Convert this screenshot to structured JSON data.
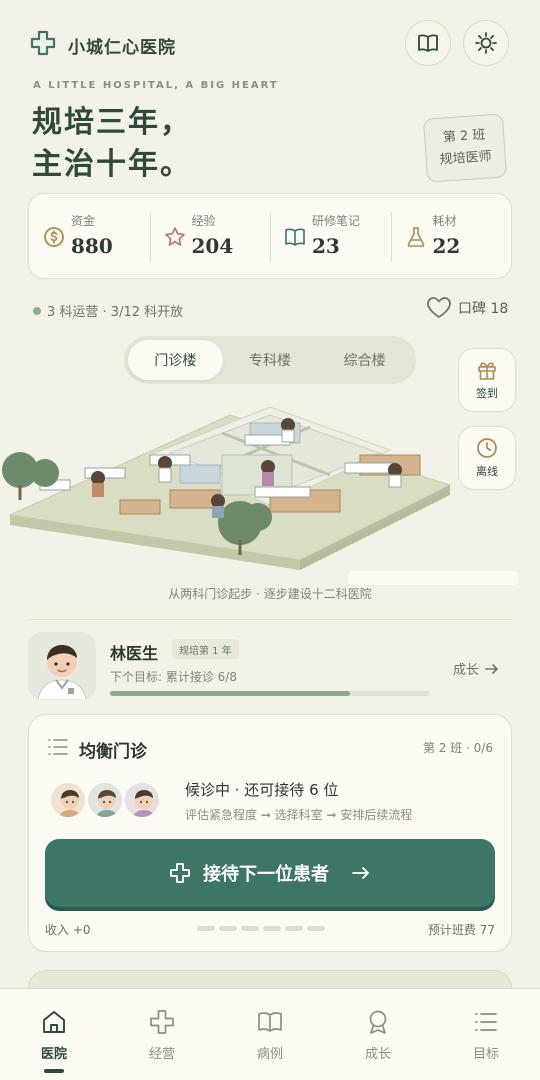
{
  "header": {
    "app_title": "小城仁心医院",
    "tagline": "A LITTLE HOSPITAL, A BIG HEART",
    "hero_line1": "规培三年，",
    "hero_line2": "主治十年。",
    "stamp_line1": "第 2 班",
    "stamp_line2": "规培医师",
    "buttons": [
      "book-icon",
      "sun-icon"
    ]
  },
  "stats": [
    {
      "label": "资金",
      "value": "880",
      "icon": "coin-icon"
    },
    {
      "label": "经验",
      "value": "204",
      "icon": "star-icon"
    },
    {
      "label": "研修笔记",
      "value": "23",
      "icon": "book-icon"
    },
    {
      "label": "耗材",
      "value": "22",
      "icon": "flask-icon"
    }
  ],
  "status": {
    "departments": "3 科运营 · 3/12 科开放",
    "reputation": "口碑 18"
  },
  "buildings": {
    "tabs": [
      "门诊楼",
      "专科楼",
      "综合楼"
    ],
    "active": 0,
    "caption": "从两科门诊起步 · 逐步建设十二科医院"
  },
  "side_buttons": [
    {
      "label": "签到",
      "icon": "gift-icon"
    },
    {
      "label": "离线",
      "icon": "clock-icon"
    }
  ],
  "doctor": {
    "name": "林医生",
    "badge": "规培第 1 年",
    "goal": "下个目标: 累计接诊 6/8",
    "progress": 0.75,
    "growth_link": "成长"
  },
  "clinic": {
    "title": "均衡门诊",
    "meta": "第 2 班 · 0/6",
    "waiting": "候诊中 · 还可接待 6 位",
    "flow": "评估紧急程度 ➞ 选择科室 ➞ 安排后续流程",
    "cta": "接待下一位患者",
    "income": "收入 +0",
    "fee": "预计班费 77",
    "pages": 6
  },
  "nav": [
    {
      "label": "医院",
      "icon": "home-icon"
    },
    {
      "label": "经营",
      "icon": "cross-icon"
    },
    {
      "label": "病例",
      "icon": "book-icon"
    },
    {
      "label": "成长",
      "icon": "medal-icon"
    },
    {
      "label": "目标",
      "icon": "list-icon"
    }
  ],
  "nav_active": 0,
  "colors": {
    "background": "#f3f2e9",
    "primary": "#3d7566",
    "primary_dark": "#2f4a3a",
    "accent_gold": "#b08a4e",
    "progress": "#8fab95"
  }
}
